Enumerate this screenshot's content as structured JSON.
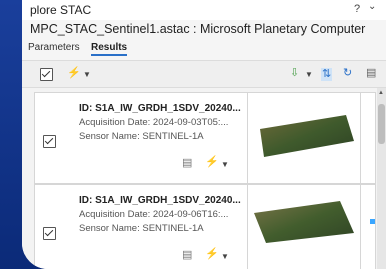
{
  "window": {
    "title": "plore STAC",
    "help": "?",
    "subtitle": "MPC_STAC_Sentinel1.astac : Microsoft Planetary Computer"
  },
  "tabs": [
    {
      "label": "Parameters",
      "active": false
    },
    {
      "label": "Results",
      "active": true
    }
  ],
  "results": [
    {
      "id": "ID: S1A_IW_GRDH_1SDV_20240...",
      "acquisition": "Acquisition Date: 2024-09-03T05:...",
      "sensor": "Sensor Name: SENTINEL-1A"
    },
    {
      "id": "ID: S1A_IW_GRDH_1SDV_20240...",
      "acquisition": "Acquisition Date: 2024-09-06T16:...",
      "sensor": "Sensor Name: SENTINEL-1A"
    }
  ],
  "colors": {
    "accent": "#2a70c8",
    "frame": "#0b2a78"
  }
}
